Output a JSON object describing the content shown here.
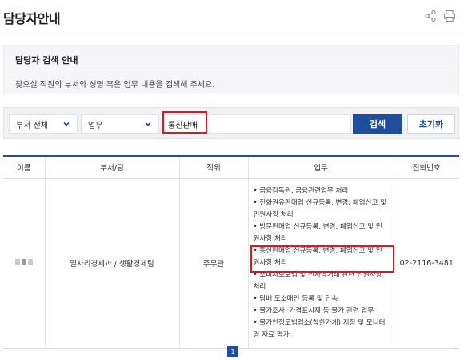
{
  "page": {
    "title": "담당자안내"
  },
  "guide": {
    "title": "담당자 검색 안내",
    "text": "찾으실 직원의 부서와 성명 혹은 업무 내용을 검색해 주세요."
  },
  "search": {
    "dept_select": "부서 전체",
    "position_select": "업무",
    "query": "통신판매",
    "search_label": "검색",
    "reset_label": "초기화"
  },
  "table": {
    "headers": [
      "이름",
      "부서/팀",
      "직위",
      "업무",
      "전화번호"
    ],
    "row": {
      "dept": "일자리경제과 / 생활경제팀",
      "position": "주무관",
      "phone": "02-2116-3481",
      "duties": [
        "• 금융감독원, 금융관련업무 처리",
        "• 전화권유판매업 신규등록, 변경, 폐업신고 및 민원사항 처리",
        "• 방문판매업 신규등록, 변경, 폐업신고 및 민원사항 처리",
        "• 통신판매업 신규등록, 변경, 폐업신고 및 민원사항 처리",
        "• 소비자보호법 및 전자상거래 관련 민원사항 처리",
        "• 담배 도소매인 등록 및 단속",
        "• 물가조사, 가격표시제 등 물가 관련 업무",
        "• 물가안정모범업소(착한가게) 지정 및 모니터링 자료 평가"
      ]
    }
  },
  "pagination": {
    "current": "1"
  },
  "colors": {
    "accent": "#1f4e9c",
    "highlight": "#e8141b"
  },
  "icons": [
    "share-icon",
    "print-icon",
    "chevron-down-icon"
  ]
}
